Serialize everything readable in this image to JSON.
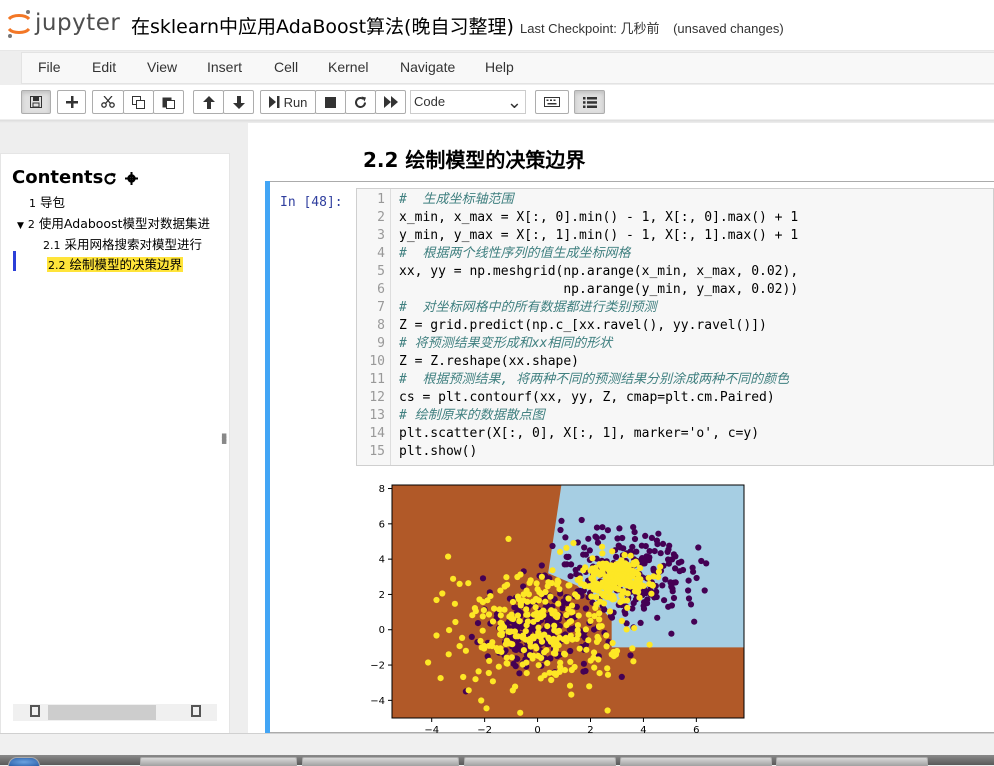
{
  "header": {
    "logo_text": "jupyter",
    "notebook_title": "在sklearn中应用AdaBoost算法(晚自习整理)",
    "checkpoint_label": "Last Checkpoint: 几秒前",
    "unsaved": "(unsaved changes)"
  },
  "menu": [
    "File",
    "Edit",
    "View",
    "Insert",
    "Cell",
    "Kernel",
    "Navigate",
    "Help"
  ],
  "toolbar": {
    "run_label": "Run",
    "cell_type": "Code"
  },
  "toc": {
    "title": "Contents",
    "items": [
      {
        "num": "1",
        "label": "导包"
      },
      {
        "num": "2",
        "label": "使用Adaboost模型对数据集进"
      },
      {
        "num": "2.1",
        "label": "采用网格搜索对模型进行"
      },
      {
        "num": "2.2",
        "label": "绘制模型的决策边界"
      }
    ]
  },
  "main": {
    "heading": "2.2  绘制模型的决策边界",
    "prompt": "In [48]:",
    "code_lines": [
      "#  生成坐标轴范围",
      "x_min, x_max = X[:, 0].min() - 1, X[:, 0].max() + 1",
      "y_min, y_max = X[:, 1].min() - 1, X[:, 1].max() + 1",
      "#  根据两个线性序列的值生成坐标网格",
      "xx, yy = np.meshgrid(np.arange(x_min, x_max, 0.02),",
      "                     np.arange(y_min, y_max, 0.02))",
      "#  对坐标网格中的所有数据都进行类别预测",
      "Z = grid.predict(np.c_[xx.ravel(), yy.ravel()])",
      "# 将预测结果变形成和xx相同的形状",
      "Z = Z.reshape(xx.shape)",
      "#  根据预测结果, 将两种不同的预测结果分别涂成两种不同的颜色",
      "cs = plt.contourf(xx, yy, Z, cmap=plt.cm.Paired)",
      "# 绘制原来的数据散点图",
      "plt.scatter(X[:, 0], X[:, 1], marker='o', c=y)",
      "plt.show()"
    ]
  },
  "chart_data": {
    "type": "scatter",
    "title": "",
    "xlabel": "",
    "ylabel": "",
    "xlim": [
      -5.5,
      7.8
    ],
    "ylim": [
      -5,
      8.2
    ],
    "x_ticks": [
      -4,
      -2,
      0,
      2,
      4,
      6
    ],
    "y_ticks": [
      -4,
      -2,
      0,
      2,
      4,
      6,
      8
    ],
    "background_colors": {
      "class0": "#a6cee3",
      "class1": "#b15928"
    },
    "series": [
      {
        "color": "#440154",
        "center": [
          0,
          0
        ],
        "spread": 1.0,
        "count": 250
      },
      {
        "color": "#440154",
        "center": [
          3.5,
          3
        ],
        "spread": 1.4,
        "count": 250
      },
      {
        "color": "#fde725",
        "center": [
          3,
          3
        ],
        "spread": 0.6,
        "count": 200
      },
      {
        "color": "#fde725",
        "center": [
          0,
          0
        ],
        "spread": 1.7,
        "count": 300
      }
    ]
  }
}
